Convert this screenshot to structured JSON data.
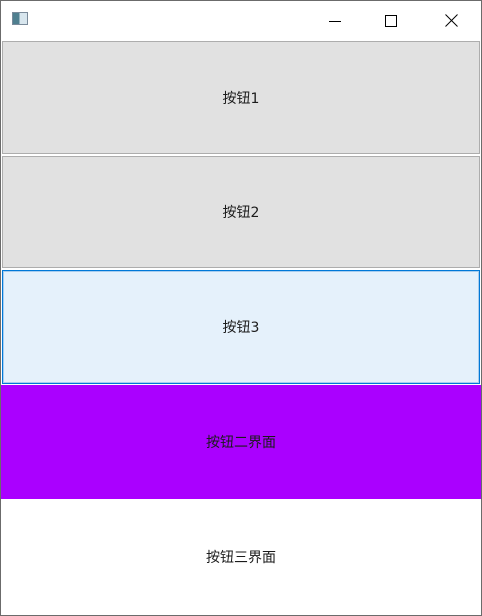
{
  "titlebar": {
    "icon": "app-window-icon",
    "controls": [
      {
        "name": "minimize",
        "icon": "minimize-icon"
      },
      {
        "name": "maximize",
        "icon": "maximize-icon"
      },
      {
        "name": "close",
        "icon": "close-icon"
      }
    ]
  },
  "buttons": [
    {
      "label": "按钮1",
      "state": "normal"
    },
    {
      "label": "按钮2",
      "state": "normal"
    },
    {
      "label": "按钮3",
      "state": "focused"
    }
  ],
  "bands": [
    {
      "label": "按钮二界面",
      "background": "#aa00ff"
    },
    {
      "label": "按钮三界面",
      "background": "#ffffff"
    }
  ],
  "colors": {
    "button_face": "#e1e1e1",
    "button_border": "#adadad",
    "focus_face": "#e5f1fb",
    "focus_border": "#0078d7",
    "purple": "#aa00ff"
  }
}
